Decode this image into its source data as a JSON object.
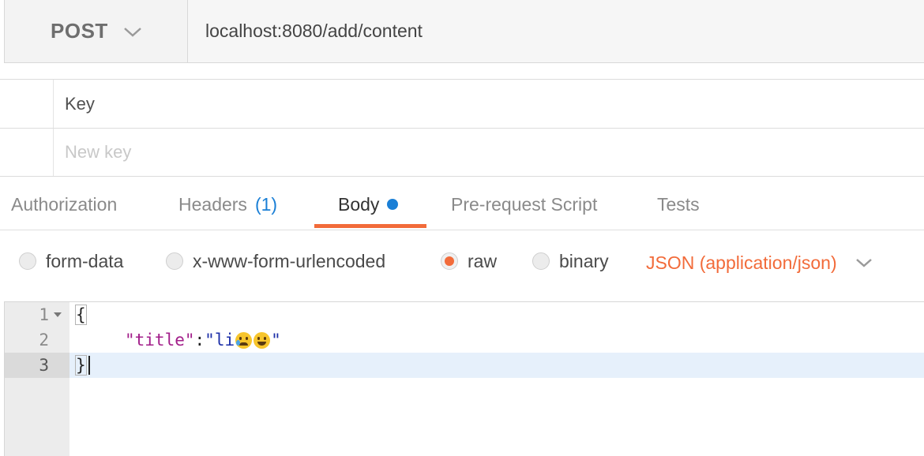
{
  "request": {
    "method": "POST",
    "url": "localhost:8080/add/content"
  },
  "params": {
    "key_header": "Key",
    "new_key_placeholder": "New key"
  },
  "tabs": [
    {
      "label": "Authorization"
    },
    {
      "label": "Headers",
      "count": "(1)"
    },
    {
      "label": "Body",
      "active": true
    },
    {
      "label": "Pre-request Script"
    },
    {
      "label": "Tests"
    }
  ],
  "body_types": [
    {
      "label": "form-data",
      "selected": false
    },
    {
      "label": "x-www-form-urlencoded",
      "selected": false
    },
    {
      "label": "raw",
      "selected": true
    },
    {
      "label": "binary",
      "selected": false
    }
  ],
  "content_type": "JSON (application/json)",
  "editor": {
    "line_numbers": [
      "1",
      "2",
      "3"
    ],
    "active_line": 3,
    "lines": {
      "open_brace": "{",
      "key": "\"title\"",
      "colon": ":",
      "value_prefix": "\"li",
      "value_suffix": "\"",
      "close_brace": "}"
    },
    "value_emojis": [
      "crying-face-icon",
      "grinning-face-icon"
    ]
  },
  "colors": {
    "accent": "#f26b3a",
    "link_blue": "#1a7fd6",
    "json_key": "#a21e8a",
    "json_string": "#1c2fa8"
  }
}
